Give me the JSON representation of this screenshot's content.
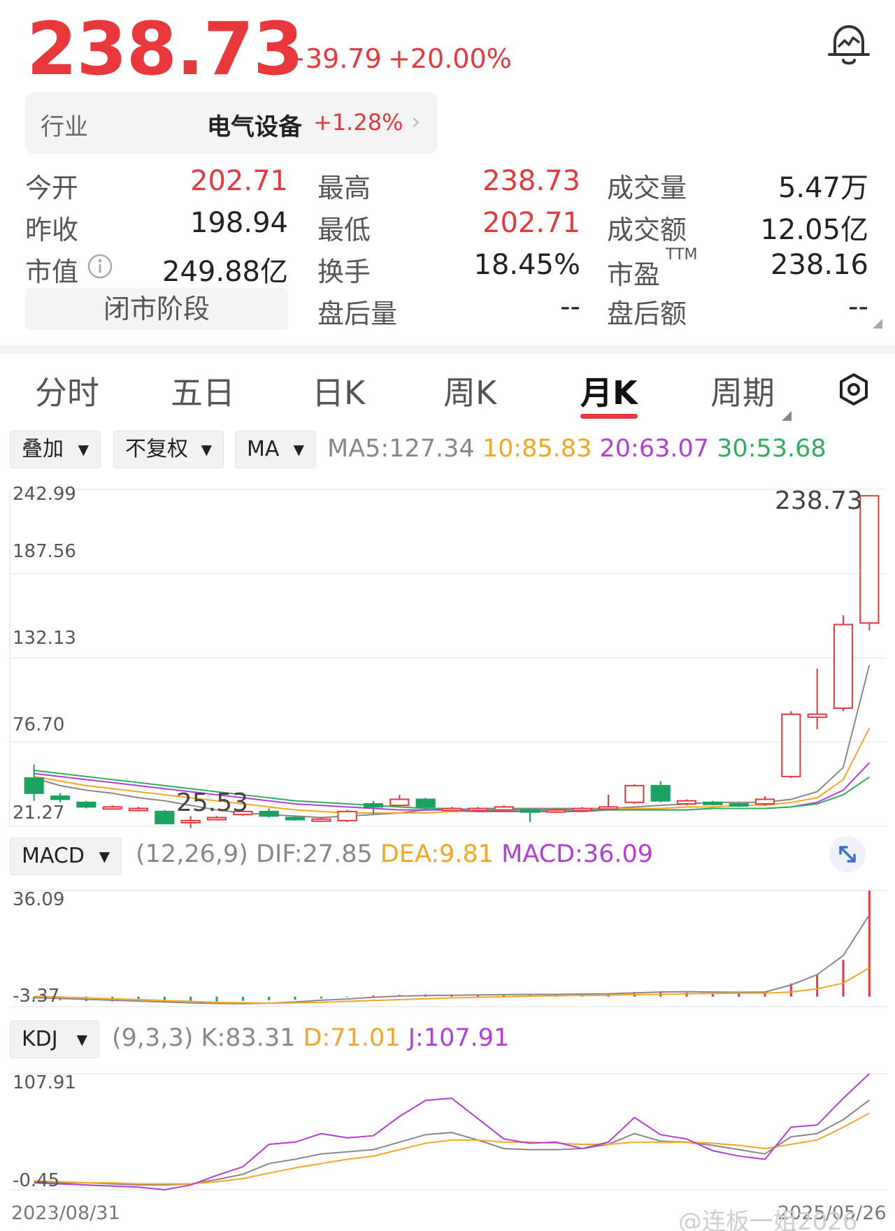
{
  "header": {
    "price": "238.73",
    "change": "+39.79",
    "change_pct": "+20.00%",
    "bell_icon": "alert-bell-icon"
  },
  "industry": {
    "label": "行业",
    "name": "电气设备",
    "change": "+1.28%",
    "arrow": "›"
  },
  "stats": {
    "col1": [
      {
        "label": "今开",
        "value": "202.71",
        "color": "#e8383b"
      },
      {
        "label": "昨收",
        "value": "198.94",
        "color": "#222222"
      },
      {
        "label": "市值",
        "value": "249.88亿",
        "color": "#222222"
      }
    ],
    "col2": [
      {
        "label": "最高",
        "value": "238.73",
        "color": "#e8383b"
      },
      {
        "label": "最低",
        "value": "202.71",
        "color": "#e8383b"
      },
      {
        "label": "换手",
        "value": "18.45%",
        "color": "#222222"
      },
      {
        "label": "盘后量",
        "value": "--",
        "color": "#222222"
      }
    ],
    "col3": [
      {
        "label": "成交量",
        "value": "5.47万",
        "color": "#222222"
      },
      {
        "label": "成交额",
        "value": "12.05亿",
        "color": "#222222"
      },
      {
        "label": "市盈",
        "value": "238.16",
        "color": "#222222"
      },
      {
        "label": "盘后额",
        "value": "--",
        "color": "#222222"
      }
    ],
    "pe_superscript": "TTM",
    "info_icon": "info-icon",
    "phase": "闭市阶段"
  },
  "tabs": [
    {
      "label": "分时",
      "active": false
    },
    {
      "label": "五日",
      "active": false
    },
    {
      "label": "日K",
      "active": false
    },
    {
      "label": "周K",
      "active": false
    },
    {
      "label": "月K",
      "active": true
    },
    {
      "label": "周期",
      "active": false
    }
  ],
  "toolbar": {
    "overlay": "叠加",
    "adjust": "不复权",
    "indicator": "MA",
    "ma5": "MA5:127.34",
    "ma10": "10:85.83",
    "ma20": "20:63.07",
    "ma30": "30:53.68",
    "settings_icon": "settings-hexagon-icon"
  },
  "main_chart": {
    "y_labels": [
      "242.99",
      "187.56",
      "132.13",
      "76.70",
      "21.27"
    ],
    "ylim": [
      21.27,
      242.99
    ],
    "high_label": "238.73",
    "low_label": "25.53"
  },
  "macd": {
    "dropdown": "MACD",
    "params": "(12,26,9)",
    "dif": "DIF:27.85",
    "dea": "DEA:9.81",
    "macd": "MACD:36.09",
    "y_top": "36.09",
    "y_bottom": "-3.37",
    "expand_icon": "expand-arrows-icon"
  },
  "kdj": {
    "dropdown": "KDJ",
    "params": "(9,3,3)",
    "k": "K:83.31",
    "d": "D:71.01",
    "j": "J:107.91",
    "y_top": "107.91",
    "y_bottom": "-0.45"
  },
  "footer": {
    "start_date": "2023/08/31",
    "end_date": "2025/05/26",
    "watermark": "@连板一姐2026"
  },
  "colors": {
    "up": "#e8383b",
    "down": "#1aa260",
    "ma5": "#888888",
    "ma10": "#f5a623",
    "ma20": "#b43ddb",
    "ma30": "#2fae5b"
  },
  "chart_data": {
    "type": "candlestick",
    "ylim": [
      21.27,
      242.99
    ],
    "candles": [
      {
        "o": 53,
        "c": 43,
        "h": 62,
        "l": 38
      },
      {
        "o": 41,
        "c": 39,
        "h": 43,
        "l": 37
      },
      {
        "o": 37,
        "c": 34,
        "h": 38,
        "l": 33
      },
      {
        "o": 34,
        "c": 34,
        "h": 35,
        "l": 33
      },
      {
        "o": 33,
        "c": 33,
        "h": 34,
        "l": 31
      },
      {
        "o": 31,
        "c": 23,
        "h": 32,
        "l": 23
      },
      {
        "o": 24,
        "c": 25,
        "h": 28,
        "l": 20
      },
      {
        "o": 27,
        "c": 27,
        "h": 28,
        "l": 26
      },
      {
        "o": 29,
        "c": 31,
        "h": 32,
        "l": 28
      },
      {
        "o": 31,
        "c": 28,
        "h": 33,
        "l": 27
      },
      {
        "o": 27,
        "c": 26,
        "h": 28,
        "l": 25
      },
      {
        "o": 26,
        "c": 26,
        "h": 27,
        "l": 25
      },
      {
        "o": 25,
        "c": 31,
        "h": 32,
        "l": 24
      },
      {
        "o": 36,
        "c": 34,
        "h": 38,
        "l": 29
      },
      {
        "o": 35,
        "c": 39,
        "h": 42,
        "l": 34
      },
      {
        "o": 39,
        "c": 34,
        "h": 40,
        "l": 33
      },
      {
        "o": 32,
        "c": 33,
        "h": 34,
        "l": 31
      },
      {
        "o": 32,
        "c": 33,
        "h": 34,
        "l": 31
      },
      {
        "o": 32,
        "c": 34,
        "h": 35,
        "l": 31
      },
      {
        "o": 32,
        "c": 31,
        "h": 33,
        "l": 24
      },
      {
        "o": 31,
        "c": 32,
        "h": 33,
        "l": 30
      },
      {
        "o": 32,
        "c": 33,
        "h": 34,
        "l": 31
      },
      {
        "o": 33,
        "c": 34,
        "h": 42,
        "l": 32
      },
      {
        "o": 37,
        "c": 48,
        "h": 49,
        "l": 36
      },
      {
        "o": 48,
        "c": 38,
        "h": 51,
        "l": 37
      },
      {
        "o": 36,
        "c": 38,
        "h": 39,
        "l": 35
      },
      {
        "o": 37,
        "c": 36,
        "h": 38,
        "l": 35
      },
      {
        "o": 36,
        "c": 35,
        "h": 37,
        "l": 34
      },
      {
        "o": 36,
        "c": 39,
        "h": 41,
        "l": 35
      },
      {
        "o": 54,
        "c": 95,
        "h": 97,
        "l": 53
      },
      {
        "o": 93,
        "c": 95,
        "h": 125,
        "l": 85
      },
      {
        "o": 99,
        "c": 154,
        "h": 160,
        "l": 97
      },
      {
        "o": 155,
        "c": 238.73,
        "h": 238.73,
        "l": 150
      }
    ],
    "ma5": [
      53,
      48,
      45,
      43,
      40,
      38,
      35,
      32,
      30,
      29,
      28,
      27,
      28,
      29,
      30,
      32,
      32,
      33,
      33,
      33,
      33,
      33,
      33,
      34,
      35,
      36,
      37,
      37,
      37,
      39,
      44,
      60,
      127.34
    ],
    "ma10": [
      54,
      51,
      48,
      46,
      44,
      42,
      40,
      38,
      36,
      34,
      32,
      31,
      30,
      30,
      30,
      30,
      31,
      31,
      32,
      32,
      32,
      32,
      33,
      33,
      33,
      34,
      34,
      35,
      35,
      37,
      40,
      52,
      85.83
    ],
    "ma20": [
      56,
      54,
      52,
      50,
      48,
      46,
      44,
      42,
      40,
      38,
      36,
      35,
      34,
      33,
      32,
      32,
      32,
      31,
      31,
      31,
      31,
      31,
      32,
      32,
      32,
      32,
      33,
      33,
      33,
      34,
      37,
      45,
      63.07
    ],
    "ma30": [
      58,
      56,
      54,
      52,
      50,
      48,
      46,
      44,
      42,
      40,
      38,
      37,
      36,
      35,
      34,
      33,
      33,
      32,
      32,
      32,
      32,
      32,
      32,
      32,
      32,
      32,
      33,
      33,
      33,
      34,
      36,
      42,
      53.68
    ],
    "macd_ylim": [
      -3.37,
      36.09
    ],
    "macd_hist": [
      -0.8,
      -1.2,
      -1.5,
      -1.6,
      -1.6,
      -1.8,
      -1.8,
      -1.6,
      -1.4,
      -1.2,
      -1.0,
      -0.6,
      -0.2,
      0.4,
      0.6,
      0.8,
      0.8,
      0.8,
      0.9,
      0.8,
      0.9,
      1.0,
      1.2,
      1.6,
      1.8,
      1.4,
      1.2,
      1.0,
      1.2,
      4.5,
      7.5,
      12.5,
      36.09
    ],
    "macd_dif": [
      -0.3,
      -0.6,
      -0.9,
      -1.2,
      -1.5,
      -1.8,
      -2.1,
      -2.3,
      -2.4,
      -2.2,
      -1.8,
      -1.2,
      -0.8,
      -0.2,
      0.2,
      0.4,
      0.5,
      0.6,
      0.7,
      0.8,
      0.8,
      0.9,
      1.0,
      1.3,
      1.6,
      1.7,
      1.6,
      1.5,
      1.6,
      4.0,
      7.5,
      14.0,
      27.85
    ],
    "macd_dea": [
      0.1,
      -0.1,
      -0.4,
      -0.7,
      -1.0,
      -1.3,
      -1.6,
      -1.9,
      -2.1,
      -2.2,
      -2.1,
      -1.9,
      -1.6,
      -1.3,
      -1.0,
      -0.7,
      -0.4,
      -0.2,
      0.0,
      0.2,
      0.3,
      0.4,
      0.5,
      0.7,
      0.8,
      1.0,
      1.1,
      1.2,
      1.2,
      1.6,
      2.7,
      4.6,
      9.81
    ],
    "kdj_ylim": [
      -0.45,
      107.91
    ],
    "kdj_k": [
      7,
      6,
      6,
      5,
      4,
      4,
      5,
      9,
      14,
      24,
      28,
      33,
      35,
      37,
      44,
      51,
      53,
      46,
      38,
      37,
      37,
      38,
      42,
      52,
      45,
      44,
      41,
      37,
      33,
      49,
      52,
      65,
      83.31
    ],
    "kdj_d": [
      8,
      7,
      6,
      6,
      5,
      5,
      5,
      7,
      10,
      15,
      20,
      24,
      28,
      31,
      37,
      43,
      46,
      46,
      44,
      44,
      43,
      42,
      42,
      44,
      44,
      44,
      43,
      41,
      38,
      42,
      46,
      58,
      71.01
    ],
    "kdj_j": [
      6,
      5,
      4,
      3,
      2,
      -0.45,
      4,
      13,
      21,
      42,
      44,
      52,
      48,
      50,
      68,
      83,
      85,
      66,
      47,
      43,
      44,
      38,
      44,
      67,
      51,
      47,
      36,
      31,
      28,
      58,
      60,
      85,
      107.91
    ]
  }
}
